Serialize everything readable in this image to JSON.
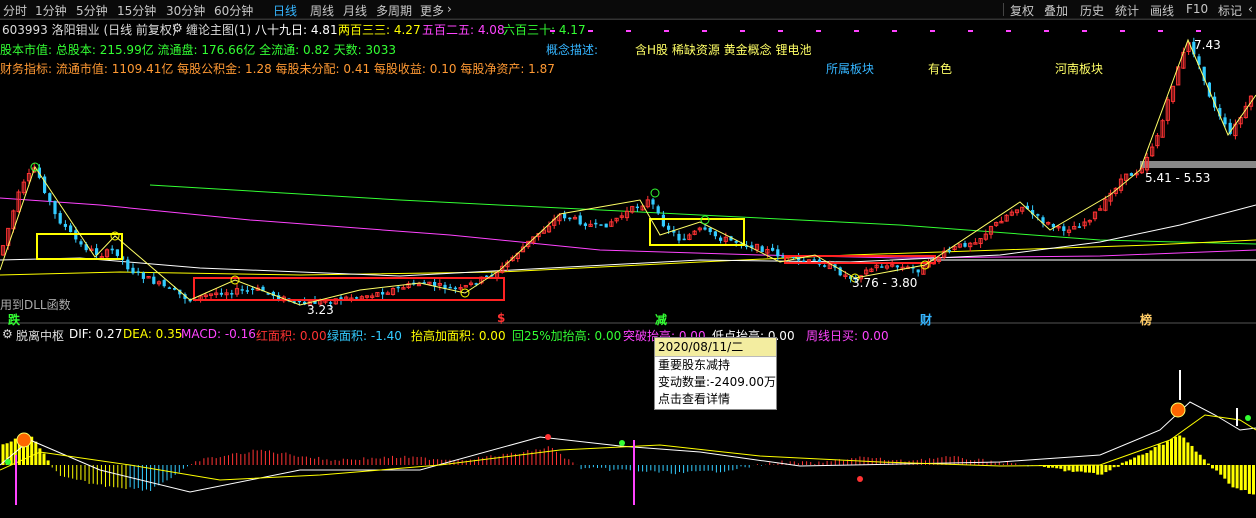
{
  "toolbar": {
    "periods": [
      "分时",
      "1分钟",
      "5分钟",
      "15分钟",
      "30分钟",
      "60分钟",
      "日线",
      "周线",
      "月线",
      "多周期",
      "更多"
    ],
    "active_period": "日线",
    "right_buttons": [
      "复权",
      "叠加",
      "历史",
      "统计",
      "画线",
      "F10",
      "标记"
    ]
  },
  "header": {
    "stock": "603993 洛阳钼业 (日线 前复权)",
    "indicator": "缠论主图(1)",
    "ma_labels": [
      {
        "label": "八十九日: 4.81",
        "color": "#ffffff"
      },
      {
        "label": "两百三三: 4.27",
        "color": "#ffff00"
      },
      {
        "label": "五百二五: 4.08",
        "color": "#ff44ff"
      },
      {
        "label": "六百三十: 4.17",
        "color": "#33ff33"
      }
    ]
  },
  "info": {
    "line1": "股本市值: 总股本: 215.99亿 流通盘: 176.66亿 全流通: 0.82 天数: 3033",
    "line2": "财务指标: 流通市值: 1109.41亿   每股公积金: 1.28   每股未分配: 0.41   每股收益: 0.10   每股净资产: 1.87",
    "concept_label": "概念描述:",
    "concept_value": "含H股 稀缺资源 黄金概念 锂电池",
    "sector_label": "所属板块",
    "sector_1": "有色",
    "sector_2": "河南板块",
    "dll_note": "用到DLL函数"
  },
  "annotations": {
    "high_price": "7.43",
    "range_right": "5.41 - 5.53",
    "range_mid": "3.76 - 3.80",
    "low_price": "3.23",
    "markers": [
      {
        "text": "跌",
        "color": "#33ff33"
      },
      {
        "text": "$",
        "color": "#ff3333"
      },
      {
        "text": "减",
        "color": "#33ff33"
      },
      {
        "text": "财",
        "color": "#35b5ff"
      },
      {
        "text": "榜",
        "color": "#ffcc66"
      }
    ]
  },
  "sub_panel": {
    "title": "脱离中枢",
    "values": [
      {
        "label": "DIF: 0.27",
        "color": "#ffffff"
      },
      {
        "label": "DEA: 0.35",
        "color": "#ffff00"
      },
      {
        "label": "MACD: -0.16",
        "color": "#ff44ff"
      },
      {
        "label": "红面积: 0.00",
        "color": "#ff3333"
      },
      {
        "label": "绿面积: -1.40",
        "color": "#33ccff"
      },
      {
        "label": "抬高加面积: 0.00",
        "color": "#ffff00"
      },
      {
        "label": "回25%加抬高: 0.00",
        "color": "#33ff33"
      },
      {
        "label": "突破抬高: 0.00",
        "color": "#ff44ff"
      },
      {
        "label": "低点抬高: 0.00",
        "color": "#ffffff"
      },
      {
        "label": "周线日买: 0.00",
        "color": "#ff44ff"
      }
    ]
  },
  "tooltip": {
    "date": "2020/08/11/二",
    "event": "重要股东减持",
    "change": "变动数量:-2409.00万",
    "link": "点击查看详情"
  },
  "colors": {
    "up": "#ff3333",
    "down": "#33ccff",
    "ma89": "#ffffff",
    "ma233": "#ffff00",
    "ma525": "#ff44ff",
    "ma630": "#33ff33"
  }
}
